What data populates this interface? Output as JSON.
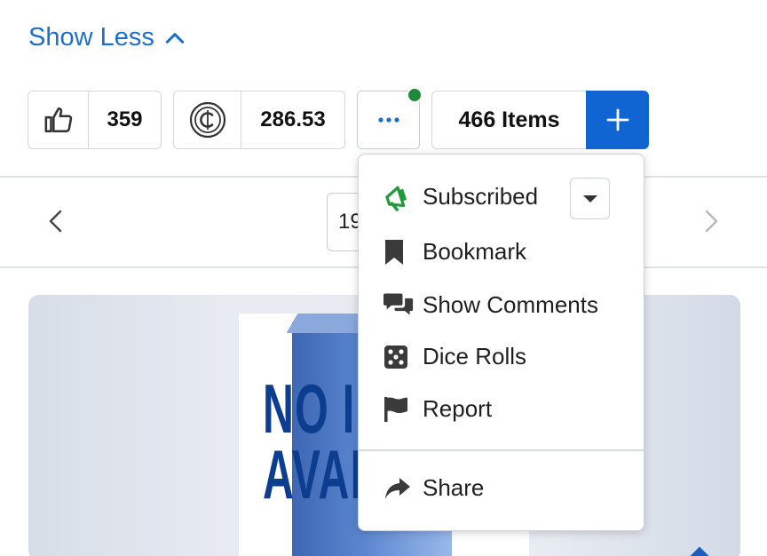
{
  "header": {
    "show_less_label": "Show Less"
  },
  "toolbar": {
    "likes_count": "359",
    "coins_count": "286.53",
    "items_label": "466 Items"
  },
  "pagination": {
    "page_value": "19"
  },
  "menu": {
    "items": [
      {
        "label": "Subscribed",
        "icon": "megaphone-icon"
      },
      {
        "label": "Bookmark",
        "icon": "bookmark-icon"
      },
      {
        "label": "Show Comments",
        "icon": "comments-icon"
      },
      {
        "label": "Dice Rolls",
        "icon": "dice-icon"
      },
      {
        "label": "Report",
        "icon": "flag-icon"
      },
      {
        "label": "Share",
        "icon": "share-icon"
      }
    ]
  },
  "image": {
    "text_line1": "NO I",
    "text_line2": "AVAI"
  },
  "colors": {
    "accent": "#1165d2",
    "link": "#1a6fd0",
    "notify": "#208a3c",
    "subscribed": "#1f9a3a"
  }
}
